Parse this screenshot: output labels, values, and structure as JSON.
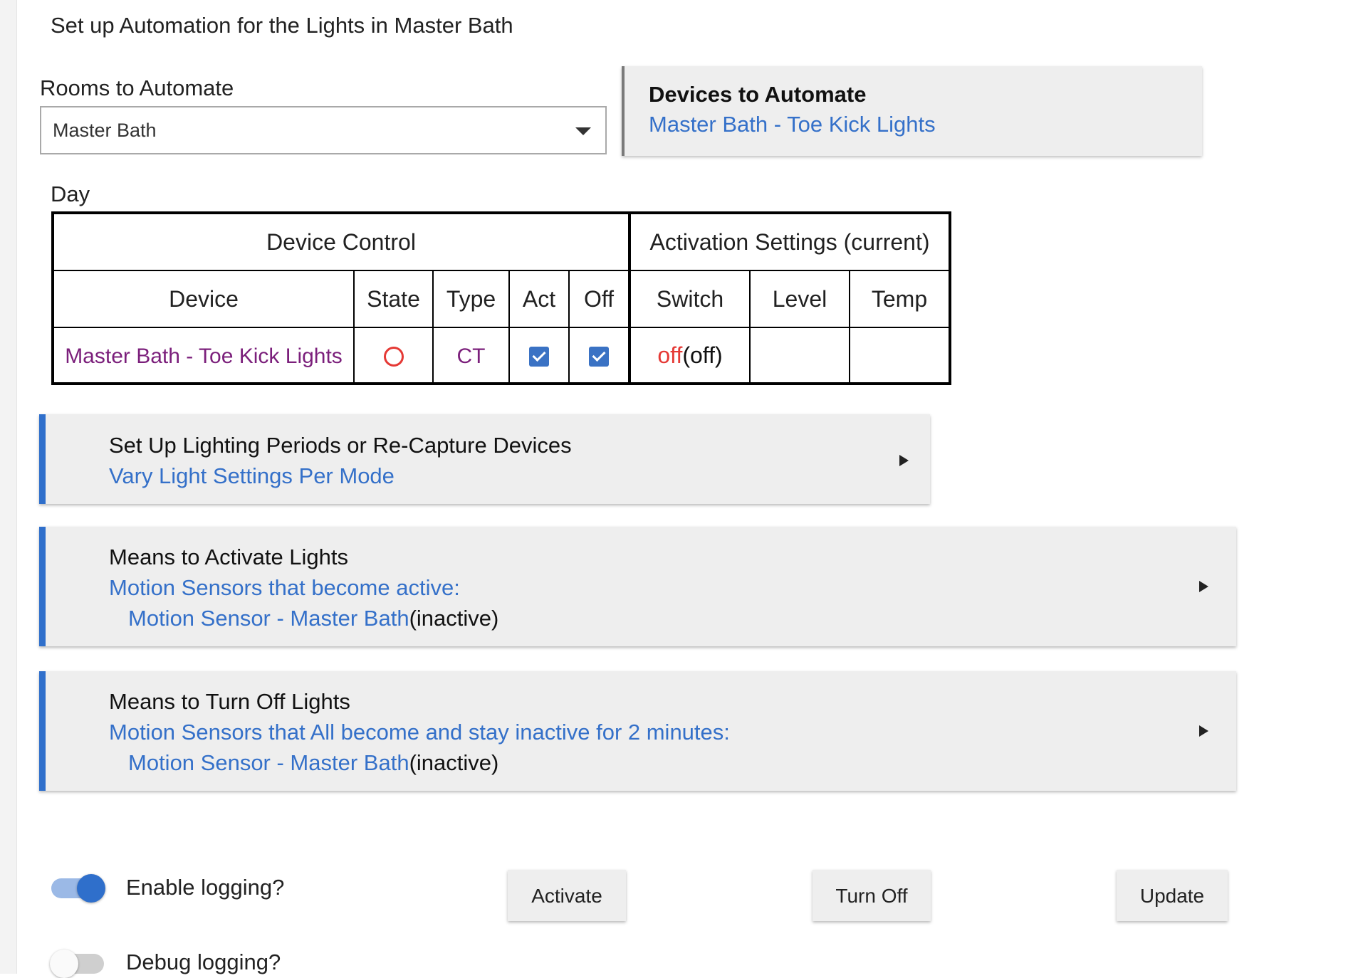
{
  "page": {
    "title": "Set up Automation for the Lights in Master Bath"
  },
  "rooms": {
    "label": "Rooms to Automate",
    "selected": "Master Bath"
  },
  "devices_card": {
    "title": "Devices to Automate",
    "device": "Master Bath - Toe Kick Lights"
  },
  "day_section": {
    "label": "Day",
    "group_headers": [
      "Device Control",
      "Activation Settings (current)"
    ],
    "columns": [
      "Device",
      "State",
      "Type",
      "Act",
      "Off",
      "Switch",
      "Level",
      "Temp"
    ],
    "rows": [
      {
        "device": "Master Bath - Toe Kick Lights",
        "state": "off",
        "type": "CT",
        "act": true,
        "off": true,
        "switch_setting": "off",
        "switch_current": "(off)",
        "level": "",
        "temp": ""
      }
    ]
  },
  "panels": {
    "lighting": {
      "title": "Set Up Lighting Periods or Re-Capture Devices",
      "subtitle": "Vary Light Settings Per Mode"
    },
    "activate": {
      "title": "Means to Activate Lights",
      "subtitle": "Motion Sensors that become active:",
      "sensor": "Motion Sensor - Master Bath",
      "sensor_state": "(inactive)"
    },
    "turnoff": {
      "title": "Means to Turn Off Lights",
      "subtitle": "Motion Sensors that All become and stay inactive for 2 minutes:",
      "sensor": "Motion Sensor - Master Bath",
      "sensor_state": "(inactive)"
    }
  },
  "toggles": {
    "enable_logging": {
      "label": "Enable logging?",
      "on": true
    },
    "debug_logging": {
      "label": "Debug logging?",
      "on": false
    }
  },
  "buttons": {
    "activate": "Activate",
    "turn_off": "Turn Off",
    "update": "Update"
  },
  "colors": {
    "accent": "#2f6fcb",
    "link": "#3470c9",
    "device_link": "#7b1f7b",
    "off_red": "#e53935"
  }
}
